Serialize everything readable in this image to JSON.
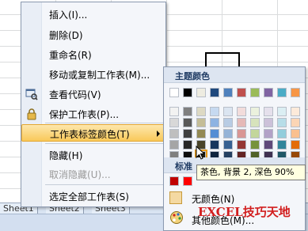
{
  "menu": {
    "items": [
      {
        "label": "插入(I)...",
        "enabled": true
      },
      {
        "label": "删除(D)",
        "enabled": true
      },
      {
        "label": "重命名(R)",
        "enabled": true
      },
      {
        "label": "移动或复制工作表(M)...",
        "enabled": true
      },
      {
        "label": "查看代码(V)",
        "enabled": true
      },
      {
        "label": "保护工作表(P)...",
        "enabled": true
      },
      {
        "label": "工作表标签颜色(T)",
        "enabled": true,
        "active": true
      },
      {
        "label": "隐藏(H)",
        "enabled": true
      },
      {
        "label": "取消隐藏(U)...",
        "enabled": false
      },
      {
        "label": "选定全部工作表(S)",
        "enabled": true
      }
    ]
  },
  "submenu": {
    "theme_header": "主题颜色",
    "standard_header": "标准",
    "no_color_label": "无颜色(N)",
    "more_colors_label": "其他颜色(M)...",
    "theme_colors": [
      "#ffffff",
      "#000000",
      "#eeece1",
      "#1f497d",
      "#4f81bd",
      "#c0504d",
      "#9bbb59",
      "#8064a2",
      "#4bacc6",
      "#f79646"
    ],
    "theme_shades": [
      [
        "#f2f2f2",
        "#7f7f7f",
        "#ddd9c3",
        "#c6d9f0",
        "#dbe5f1",
        "#f2dcdb",
        "#ebf1dd",
        "#e5e0ec",
        "#dbeef3",
        "#fdeada"
      ],
      [
        "#d8d8d8",
        "#595959",
        "#c4bd97",
        "#8db3e2",
        "#b8cce4",
        "#e5b9b7",
        "#d7e3bc",
        "#ccc1d9",
        "#b7dde8",
        "#fbd5b5"
      ],
      [
        "#bfbfbf",
        "#3f3f3f",
        "#938953",
        "#548dd4",
        "#95b3d7",
        "#d99694",
        "#c3d69b",
        "#b2a2c7",
        "#92cddc",
        "#fac08f"
      ],
      [
        "#a5a5a5",
        "#262626",
        "#494429",
        "#17365d",
        "#366092",
        "#953734",
        "#76923c",
        "#5f497a",
        "#31859b",
        "#e36c09"
      ],
      [
        "#7f7f7f",
        "#0c0c0c",
        "#1d1b10",
        "#0f243e",
        "#244061",
        "#632423",
        "#4f6128",
        "#3f3151",
        "#205867",
        "#974806"
      ]
    ],
    "standard_colors": [
      "#c00000",
      "#ff0000"
    ]
  },
  "tooltip": {
    "text": "茶色, 背景 2, 深色 90%"
  },
  "tabs": [
    "Sheet1",
    "Sheet2",
    "Sheet3"
  ],
  "watermark": "EXCEL技巧天地"
}
